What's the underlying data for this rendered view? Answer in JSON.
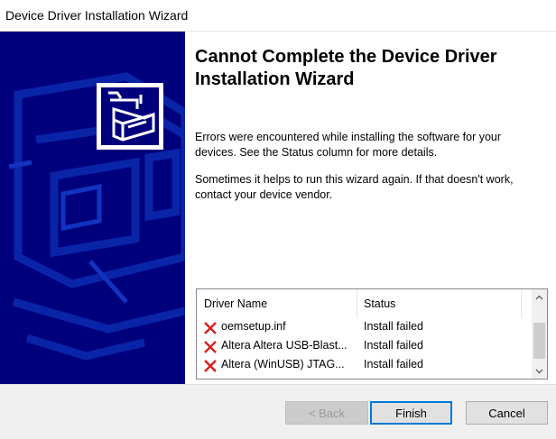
{
  "window": {
    "title": "Device Driver Installation Wizard"
  },
  "main": {
    "heading": "Cannot Complete the Device Driver Installation Wizard",
    "paragraph1": "Errors were encountered while installing the software for your devices. See the Status column for more details.",
    "paragraph2": "Sometimes it helps to run this wizard again. If that doesn't work, contact your device vendor."
  },
  "driver_list": {
    "columns": [
      "Driver Name",
      "Status"
    ],
    "rows": [
      {
        "name": "oemsetup.inf",
        "status": "Install failed",
        "icon": "error-x-icon"
      },
      {
        "name": "Altera Altera USB-Blast...",
        "status": "Install failed",
        "icon": "error-x-icon"
      },
      {
        "name": "Altera (WinUSB) JTAG...",
        "status": "Install failed",
        "icon": "error-x-icon"
      }
    ]
  },
  "buttons": {
    "back": "< Back",
    "finish": "Finish",
    "cancel": "Cancel"
  },
  "colors": {
    "side_panel": "#00007d",
    "error_icon": "#d81e1e",
    "focus_border": "#0078d7"
  }
}
